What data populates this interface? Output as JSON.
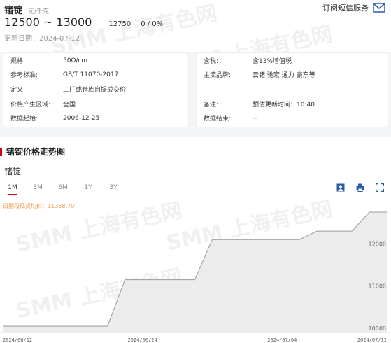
{
  "product": {
    "name": "锗锭",
    "unit": "元/千克",
    "price_range": "12500 ~ 13000",
    "price_avg": "12750",
    "price_change": "0 / 0%",
    "update_date": "更新日期：2024-07-12"
  },
  "subscribe": {
    "label": "订阅短信服务",
    "icon": "mail-icon"
  },
  "info_left": [
    {
      "key": "规格:",
      "value": "50Ω/cm"
    },
    {
      "key": "参考标准:",
      "value": "GB/T 11070-2017"
    },
    {
      "key": "定义:",
      "value": "工厂或仓库自提成交价"
    },
    {
      "key": "价格产生区域:",
      "value": "全国"
    },
    {
      "key": "数据起始:",
      "value": "2006-12-25"
    }
  ],
  "info_right": [
    {
      "key": "含税:",
      "value": "含13%增值税"
    },
    {
      "key": "主流品牌:",
      "value": "云锗 驰宏 通力 豪东等"
    },
    {
      "key": "",
      "value": ""
    },
    {
      "key": "备注:",
      "value": "预估更新时间：10:40"
    },
    {
      "key": "数据结束:",
      "value": "--"
    }
  ],
  "section_title": "锗锭价格走势图",
  "chart_header": {
    "name": "锗锭",
    "tabs": [
      "1M",
      "3M",
      "6M",
      "1Y",
      "3Y"
    ],
    "active_tab": "1M",
    "avg_note": "日期段现货均价：11358.70",
    "tools": [
      "image-icon",
      "print-icon",
      "fullscreen-icon"
    ]
  },
  "watermark_text": "SMM 上海有色网",
  "colors": {
    "accent": "#d0021b",
    "line": "#999999",
    "area": "#ececec",
    "avg": "#f2994a"
  },
  "chart_data": {
    "type": "area",
    "title": "",
    "xlabel": "",
    "ylabel": "",
    "x_ticks": [
      "2024/06/12",
      "2024/06/24",
      "2024/07/04",
      "2024/07/12"
    ],
    "y_ticks": [
      10000,
      11000,
      12000
    ],
    "ylim": [
      9900,
      12800
    ],
    "grid": false,
    "x": [
      "2024/06/12",
      "2024/06/13",
      "2024/06/14",
      "2024/06/17",
      "2024/06/18",
      "2024/06/19",
      "2024/06/20",
      "2024/06/21",
      "2024/06/24",
      "2024/06/25",
      "2024/06/26",
      "2024/06/27",
      "2024/06/28",
      "2024/07/01",
      "2024/07/02",
      "2024/07/03",
      "2024/07/04",
      "2024/07/05",
      "2024/07/08",
      "2024/07/09",
      "2024/07/10",
      "2024/07/11",
      "2024/07/12"
    ],
    "series": [
      {
        "values": [
          10050,
          10050,
          10050,
          10050,
          10050,
          10050,
          10050,
          11150,
          11150,
          11150,
          11150,
          11150,
          12100,
          12100,
          12100,
          12100,
          12100,
          12100,
          12300,
          12300,
          12300,
          12750,
          12750
        ]
      }
    ]
  }
}
